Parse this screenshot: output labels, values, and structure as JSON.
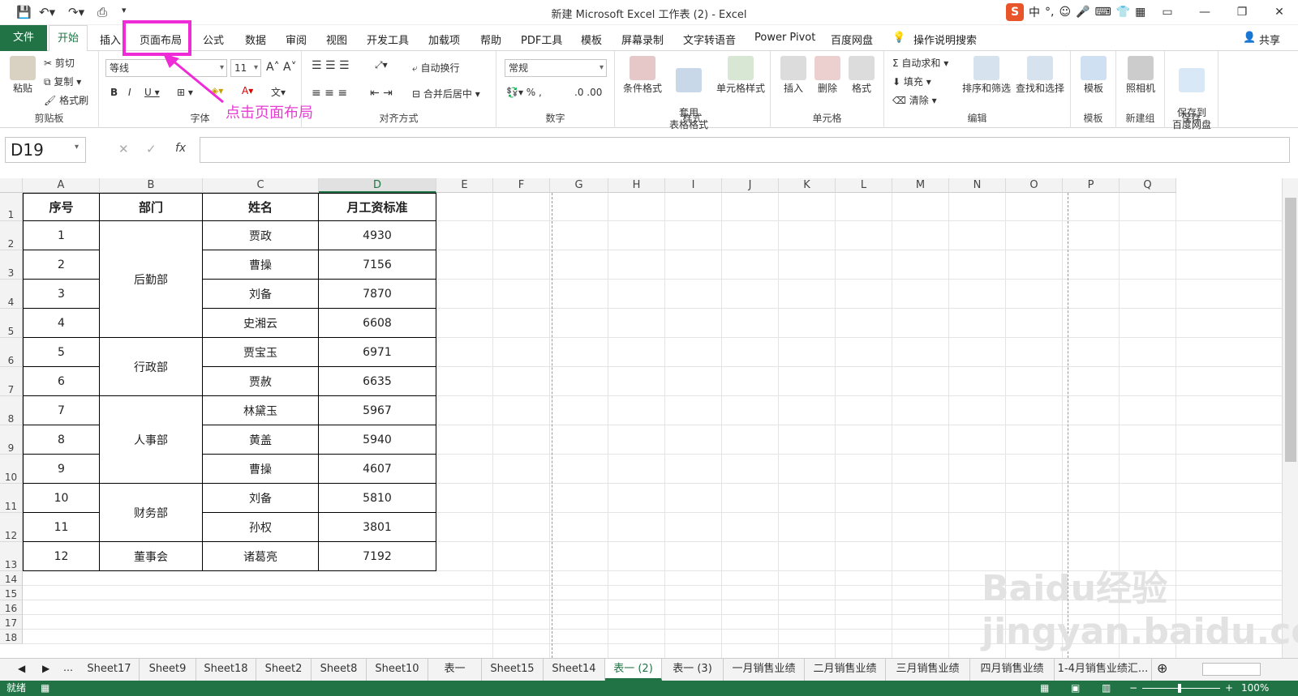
{
  "window": {
    "title": "新建 Microsoft Excel 工作表 (2)  -  Excel"
  },
  "ime": {
    "items": [
      "中",
      "°,",
      "☺",
      "🎤",
      "⌨",
      "👕",
      "▦"
    ]
  },
  "menu": {
    "file": "文件",
    "tabs": [
      "开始",
      "插入",
      "页面布局",
      "公式",
      "数据",
      "审阅",
      "视图",
      "开发工具",
      "加载项",
      "帮助",
      "PDF工具",
      "模板",
      "屏幕录制",
      "文字转语音",
      "Power Pivot",
      "百度网盘"
    ],
    "search": "操作说明搜索",
    "share": "共享"
  },
  "annotation": "点击页面布局",
  "ribbon": {
    "clipboard": {
      "label": "剪贴板",
      "paste": "粘贴",
      "cut": "剪切",
      "copy": "复制",
      "format_painter": "格式刷"
    },
    "font": {
      "label": "字体",
      "name": "等线",
      "size": "11"
    },
    "alignment": {
      "label": "对齐方式",
      "wrap": "自动换行",
      "merge": "合并后居中"
    },
    "number": {
      "label": "数字",
      "format": "常规"
    },
    "styles": {
      "label": "样式",
      "conditional": "条件格式",
      "table": "套用\n表格格式",
      "cell": "单元格样式"
    },
    "cells": {
      "label": "单元格",
      "insert": "插入",
      "delete": "删除",
      "format": "格式"
    },
    "editing": {
      "label": "编辑",
      "autosum": "自动求和",
      "fill": "填充",
      "clear": "清除",
      "sort": "排序和筛选",
      "find": "查找和选择"
    },
    "template": {
      "label": "模板",
      "btn": "模板"
    },
    "newgroup": {
      "label": "新建组",
      "btn": "照相机"
    },
    "save": {
      "label": "保存",
      "btn": "保存到\n百度网盘"
    }
  },
  "formula": {
    "namebox": "D19",
    "value": ""
  },
  "columns": [
    "A",
    "B",
    "C",
    "D",
    "E",
    "F",
    "G",
    "H",
    "I",
    "J",
    "K",
    "L",
    "M",
    "N",
    "O",
    "P",
    "Q"
  ],
  "rows": [
    "1",
    "2",
    "3",
    "4",
    "5",
    "6",
    "7",
    "8",
    "9",
    "10",
    "11",
    "12",
    "13",
    "14",
    "15",
    "16",
    "17",
    "18"
  ],
  "table": {
    "headers": [
      "序号",
      "部门",
      "姓名",
      "月工资标准"
    ],
    "numbers": [
      "1",
      "2",
      "3",
      "4",
      "5",
      "6",
      "7",
      "8",
      "9",
      "10",
      "11",
      "12"
    ],
    "departments": [
      "后勤部",
      "行政部",
      "人事部",
      "财务部",
      "董事会"
    ],
    "names": [
      "贾政",
      "曹操",
      "刘备",
      "史湘云",
      "贾宝玉",
      "贾赦",
      "林黛玉",
      "黄盖",
      "曹操",
      "刘备",
      "孙权",
      "诸葛亮"
    ],
    "salaries": [
      "4930",
      "7156",
      "7870",
      "6608",
      "6971",
      "6635",
      "5967",
      "5940",
      "4607",
      "5810",
      "3801",
      "7192"
    ]
  },
  "sheets": [
    "Sheet17",
    "Sheet9",
    "Sheet18",
    "Sheet2",
    "Sheet8",
    "Sheet10",
    "表一",
    "Sheet15",
    "Sheet14",
    "表一 (2)",
    "表一 (3)",
    "一月销售业绩",
    "二月销售业绩",
    "三月销售业绩",
    "四月销售业绩",
    "1-4月销售业绩汇..."
  ],
  "status": {
    "ready": "就绪",
    "zoom": "100%"
  },
  "watermark": "Baidu经验 jingyan.baidu.com"
}
